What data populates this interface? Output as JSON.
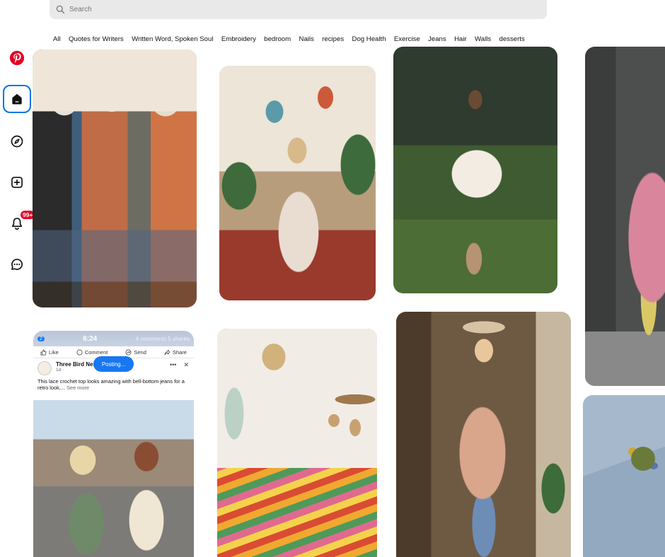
{
  "search": {
    "placeholder": "Search"
  },
  "categories": [
    "All",
    "Quotes for Writers",
    "Written Word, Spoken Soul",
    "Embroidery",
    "bedroom",
    "Nails",
    "recipes",
    "Dog Health",
    "Exercise",
    "Jeans",
    "Hair",
    "Walls",
    "desserts"
  ],
  "rail": {
    "items": [
      {
        "name": "pinterest-logo-icon"
      },
      {
        "name": "home-icon",
        "active": true
      },
      {
        "name": "explore-icon"
      },
      {
        "name": "create-icon"
      },
      {
        "name": "notifications-icon",
        "badge": "99+"
      },
      {
        "name": "messages-icon"
      }
    ]
  },
  "fb_post": {
    "status_time": "6:24",
    "reactions_count": "2",
    "comments_shares": "4 comments  5 shares",
    "like": "Like",
    "comment": "Comment",
    "send": "Send",
    "share": "Share",
    "posting": "Posting...",
    "page_name": "Three Bird Nest",
    "post_time": "1d · ",
    "text": "This lace crochet top looks amazing with bell-bottom jeans for a retro look....",
    "see_more": "See more",
    "avatar_text": "Three Bird Nest"
  },
  "colors": {
    "brand": "#e60023",
    "accent": "#0074e8",
    "facebook": "#1877f2"
  }
}
